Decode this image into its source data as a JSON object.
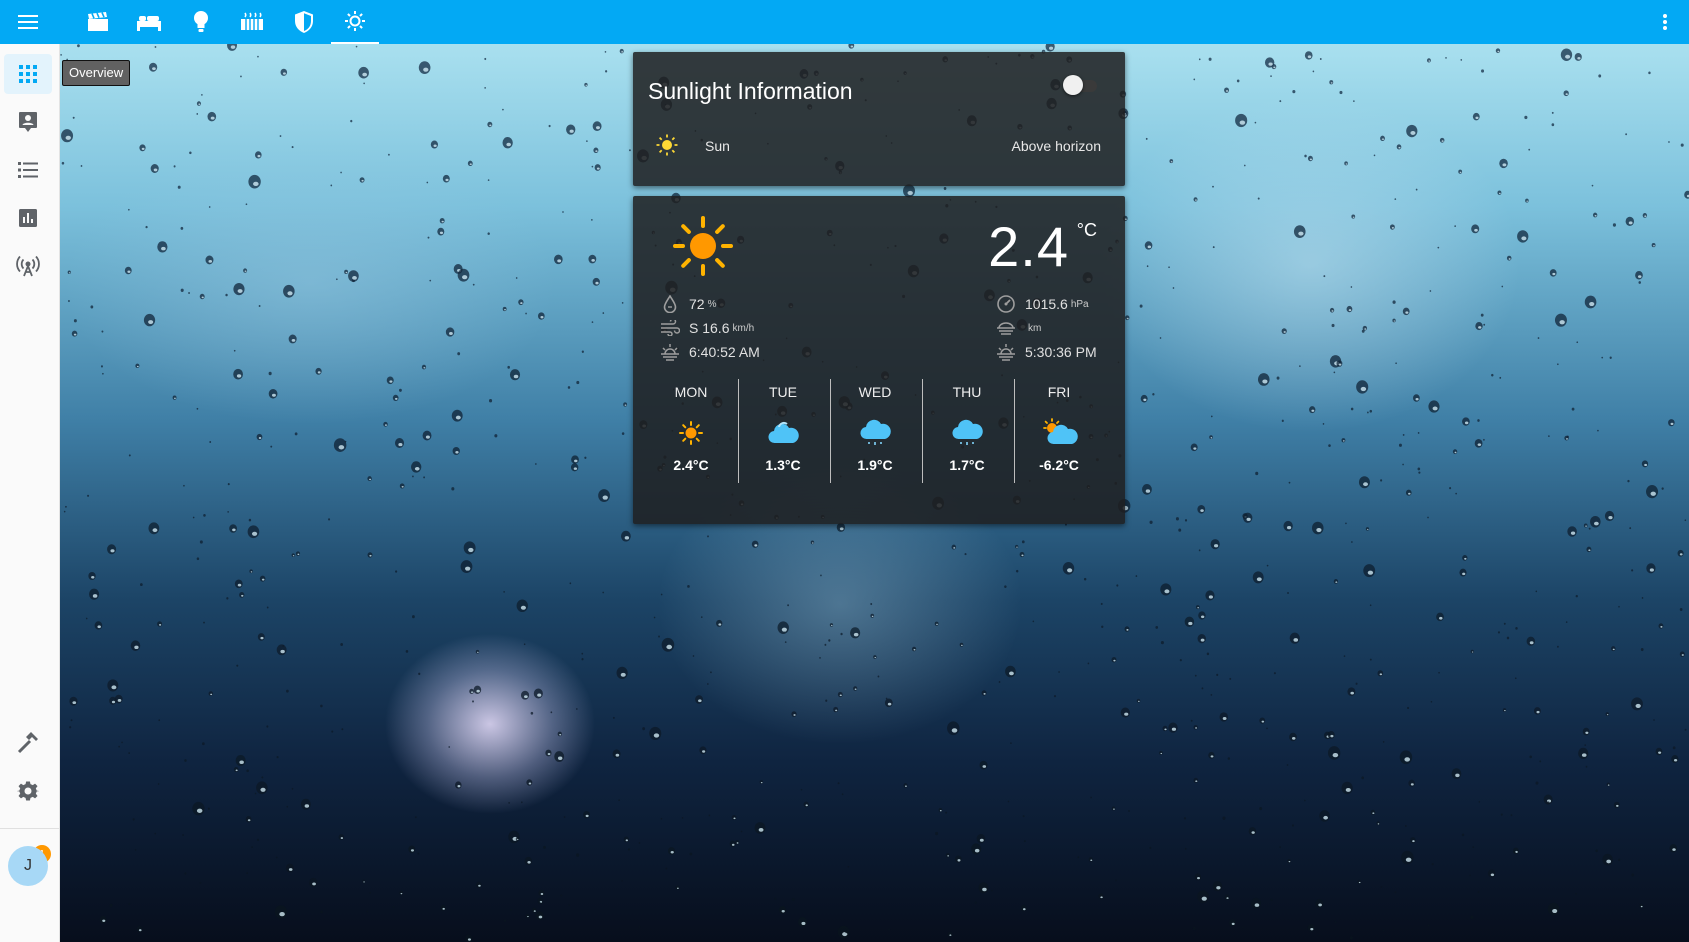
{
  "topbar": {
    "menu_icon": "hamburger-menu-icon",
    "tabs": [
      {
        "icon": "movie-clapper-icon"
      },
      {
        "icon": "bed-icon"
      },
      {
        "icon": "lightbulb-icon"
      },
      {
        "icon": "radiator-icon"
      },
      {
        "icon": "shield-icon"
      },
      {
        "icon": "sun-settings-icon",
        "active": true
      }
    ],
    "more_icon": "dots-vertical-icon",
    "color": "#03a9f4"
  },
  "sidebar": {
    "items": [
      {
        "name": "overview",
        "icon": "grid-icon",
        "active": true
      },
      {
        "name": "map",
        "icon": "account-box-icon"
      },
      {
        "name": "logbook",
        "icon": "list-icon"
      },
      {
        "name": "history",
        "icon": "chart-icon"
      },
      {
        "name": "developer",
        "icon": "antenna-icon"
      }
    ],
    "bottom": [
      {
        "name": "hammer",
        "icon": "hammer-icon"
      },
      {
        "name": "settings",
        "icon": "gear-icon"
      }
    ],
    "notifications": {
      "icon": "bell-icon",
      "count": "1"
    },
    "avatar_letter": "J"
  },
  "tooltip": {
    "text": "Overview"
  },
  "sun_card": {
    "title": "Sunlight Information",
    "toggle_on": false,
    "entity": {
      "icon": "sun-icon",
      "name": "Sun",
      "state": "Above horizon"
    }
  },
  "weather_card": {
    "temperature": "2.4",
    "unit": "°C",
    "icon": "sunny-icon",
    "attributes_left": [
      {
        "icon": "humidity-icon",
        "value": "72",
        "unit": "%"
      },
      {
        "icon": "wind-icon",
        "value": "S 16.6",
        "unit": "km/h"
      },
      {
        "icon": "sunrise-icon",
        "value": "6:40:52 AM",
        "unit": ""
      }
    ],
    "attributes_right": [
      {
        "icon": "pressure-gauge-icon",
        "value": "1015.6",
        "unit": "hPa"
      },
      {
        "icon": "visibility-icon",
        "value": "",
        "unit": "km"
      },
      {
        "icon": "sunset-icon",
        "value": "5:30:36 PM",
        "unit": ""
      }
    ],
    "forecast": [
      {
        "day": "MON",
        "icon": "sunny-icon",
        "temp": "2.4°C"
      },
      {
        "day": "TUE",
        "icon": "cloudy-icon",
        "temp": "1.3°C"
      },
      {
        "day": "WED",
        "icon": "cloudy-rain-icon",
        "temp": "1.9°C"
      },
      {
        "day": "THU",
        "icon": "cloudy-rain-icon",
        "temp": "1.7°C"
      },
      {
        "day": "FRI",
        "icon": "partly-cloudy-icon",
        "temp": "-6.2°C"
      }
    ]
  }
}
